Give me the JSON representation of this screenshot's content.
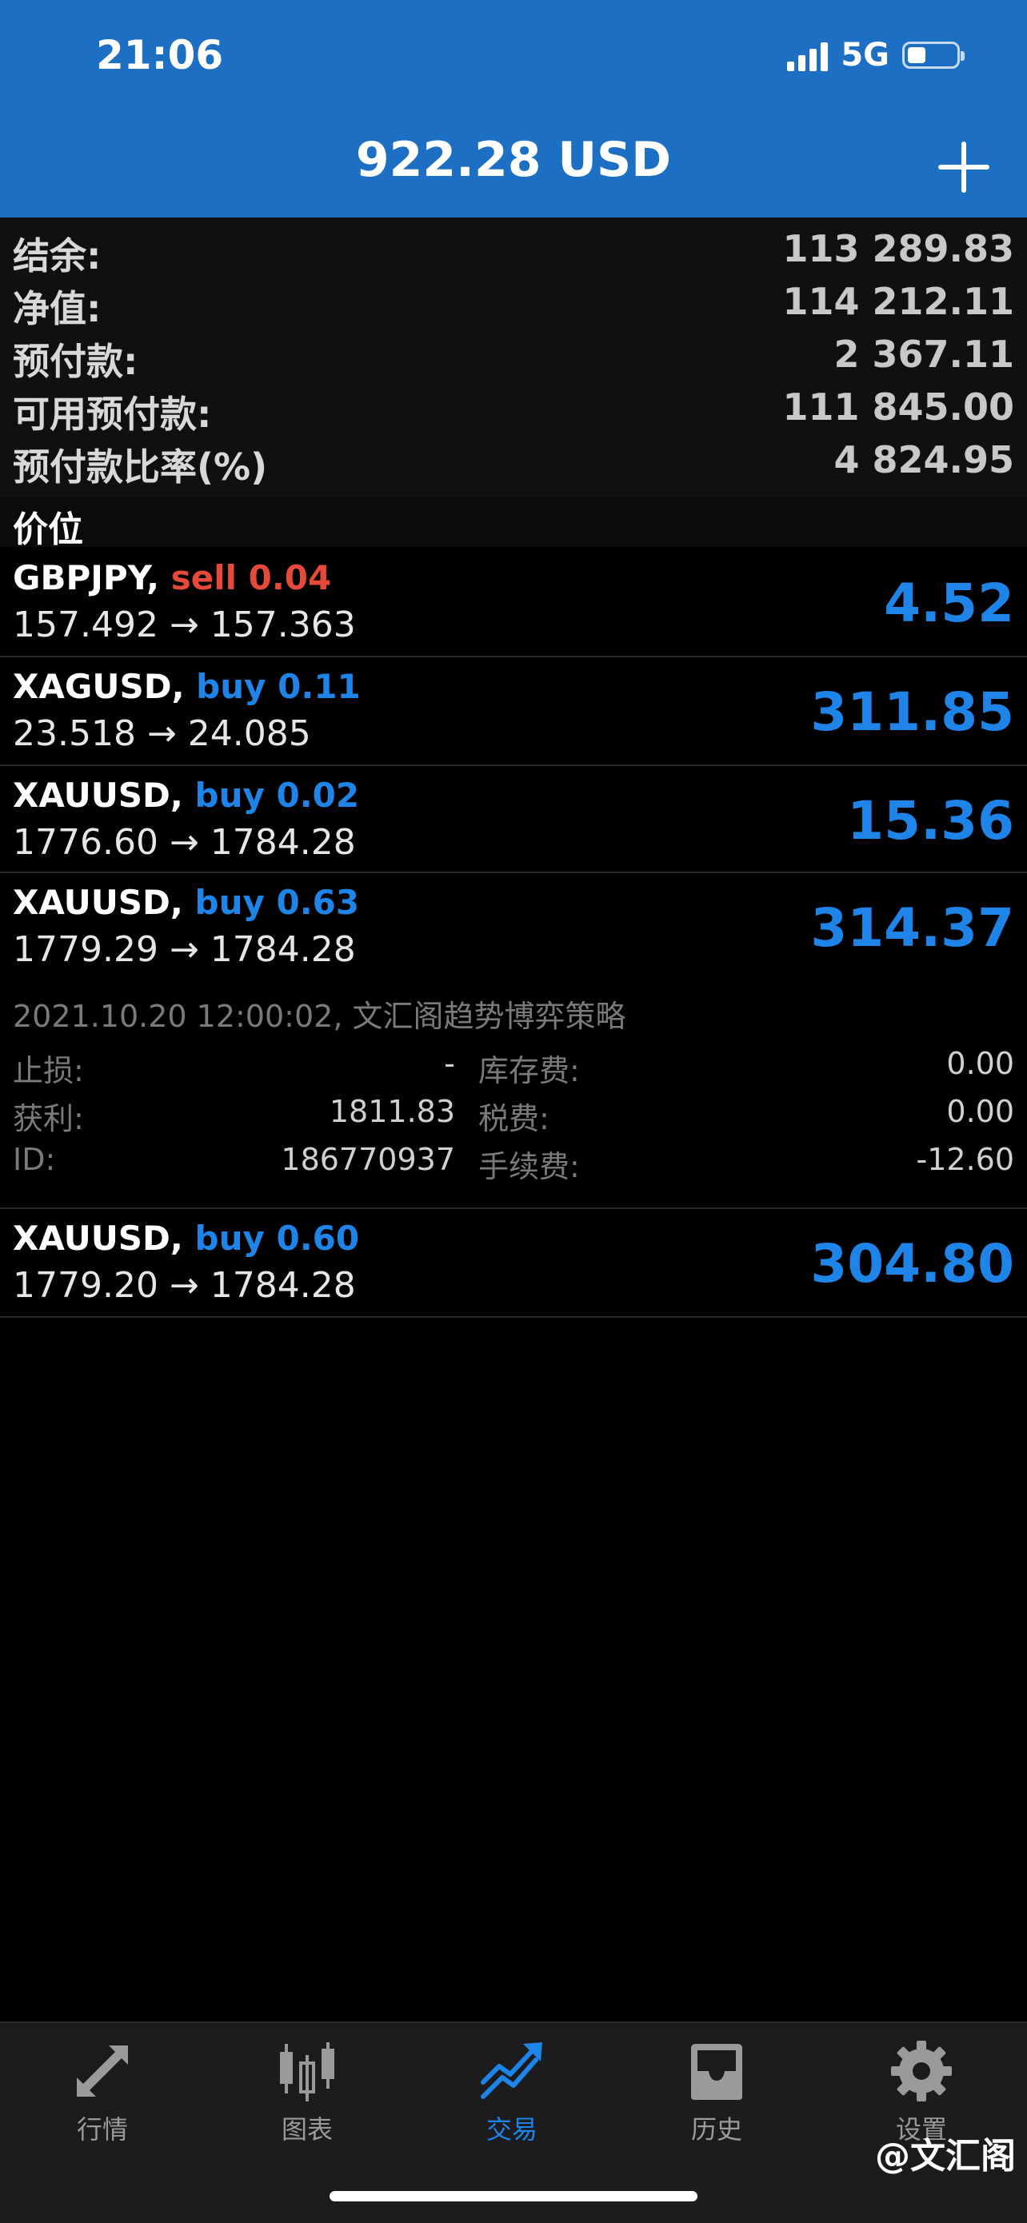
{
  "status_bar": {
    "time": "21:06",
    "network": "5G"
  },
  "header": {
    "title": "922.28 USD"
  },
  "summary": [
    {
      "label": "结余:",
      "value": "113 289.83"
    },
    {
      "label": "净值:",
      "value": "114 212.11"
    },
    {
      "label": "预付款:",
      "value": "2 367.11"
    },
    {
      "label": "可用预付款:",
      "value": "111 845.00"
    },
    {
      "label": "预付款比率(%)",
      "value": "4 824.95"
    }
  ],
  "section": {
    "title": "价位"
  },
  "positions": [
    {
      "symbol": "GBPJPY,",
      "side": "sell 0.04",
      "prices": "157.492 → 157.363",
      "profit": "4.52"
    },
    {
      "symbol": "XAGUSD,",
      "side": "buy 0.11",
      "prices": "23.518 → 24.085",
      "profit": "311.85"
    },
    {
      "symbol": "XAUUSD,",
      "side": "buy 0.02",
      "prices": "1776.60 → 1784.28",
      "profit": "15.36"
    },
    {
      "symbol": "XAUUSD,",
      "side": "buy 0.63",
      "prices": "1779.29 → 1784.28",
      "profit": "314.37"
    },
    {
      "symbol": "XAUUSD,",
      "side": "buy 0.60",
      "prices": "1779.20 → 1784.28",
      "profit": "304.80"
    }
  ],
  "expanded": {
    "date_comment": "2021.10.20 12:00:02, 文汇阁趋势博弈策略",
    "sl_label": "止损:",
    "sl_value": "-",
    "tp_label": "获利:",
    "tp_value": "1811.83",
    "id_label": "ID:",
    "id_value": "186770937",
    "swap_label": "库存费:",
    "swap_value": "0.00",
    "tax_label": "税费:",
    "tax_value": "0.00",
    "commission_label": "手续费:",
    "commission_value": "-12.60"
  },
  "tabs": [
    {
      "label": "行情",
      "icon": "quotes-icon"
    },
    {
      "label": "图表",
      "icon": "chart-icon"
    },
    {
      "label": "交易",
      "icon": "trade-icon",
      "active": true
    },
    {
      "label": "历史",
      "icon": "history-icon"
    },
    {
      "label": "设置",
      "icon": "settings-icon"
    }
  ],
  "watermark": "@文汇阁",
  "colors": {
    "header_bg": "#1d6fc4",
    "buy": "#1e84e8",
    "sell": "#e5493a",
    "active_tab": "#1e84e8"
  }
}
